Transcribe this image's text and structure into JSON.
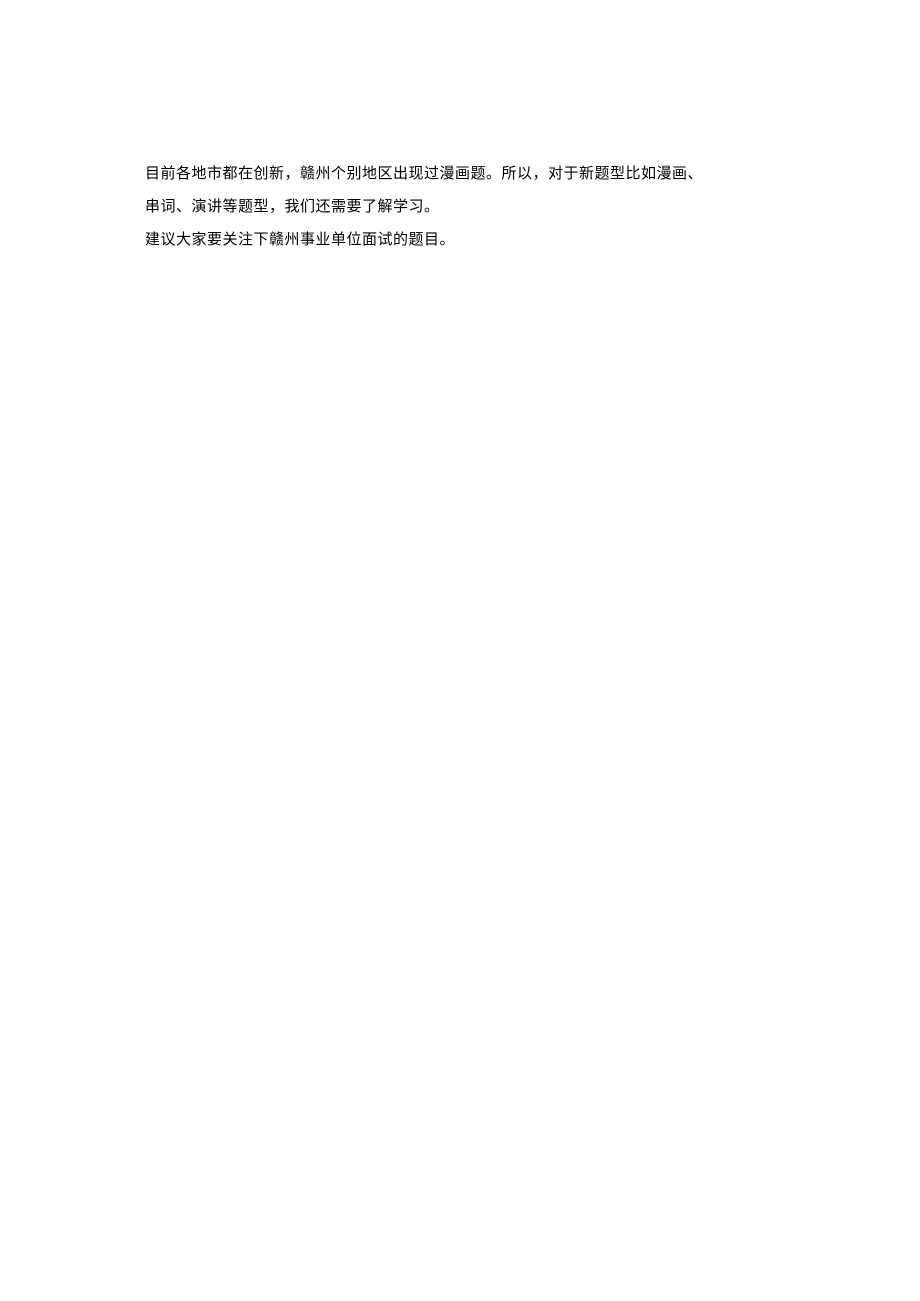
{
  "document": {
    "paragraphs": [
      "目前各地市都在创新，赣州个别地区出现过漫画题。所以，对于新题型比如漫画、",
      "串词、演讲等题型，我们还需要了解学习。",
      "建议大家要关注下赣州事业单位面试的题目。"
    ]
  }
}
